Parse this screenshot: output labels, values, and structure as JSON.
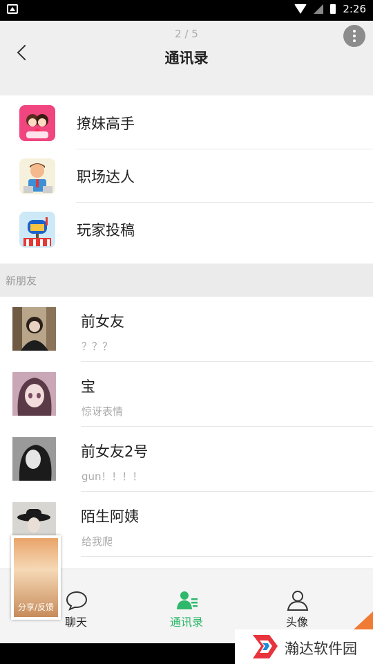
{
  "status_bar": {
    "time": "2:26"
  },
  "header": {
    "pager": "2 / 5",
    "title": "通讯录"
  },
  "fixed_items": [
    {
      "label": "撩妹高手"
    },
    {
      "label": "职场达人"
    },
    {
      "label": "玩家投稿"
    }
  ],
  "section": {
    "label": "新朋友"
  },
  "friends": [
    {
      "name": "前女友",
      "message": "？？？"
    },
    {
      "name": "宝",
      "message": "惊讶表情"
    },
    {
      "name": "前女友2号",
      "message": "gun！！！！"
    },
    {
      "name": "陌生阿姨",
      "message": "给我爬"
    }
  ],
  "tabs": [
    {
      "label": "聊天"
    },
    {
      "label": "通讯录"
    },
    {
      "label": "头像"
    }
  ],
  "thumbnail": {
    "label": "分享/反馈"
  },
  "watermark": {
    "text": "瀚达软件园"
  },
  "colors": {
    "active_tab": "#2eb86b",
    "header_bg": "#efefef",
    "section_bg": "#ebebeb"
  }
}
